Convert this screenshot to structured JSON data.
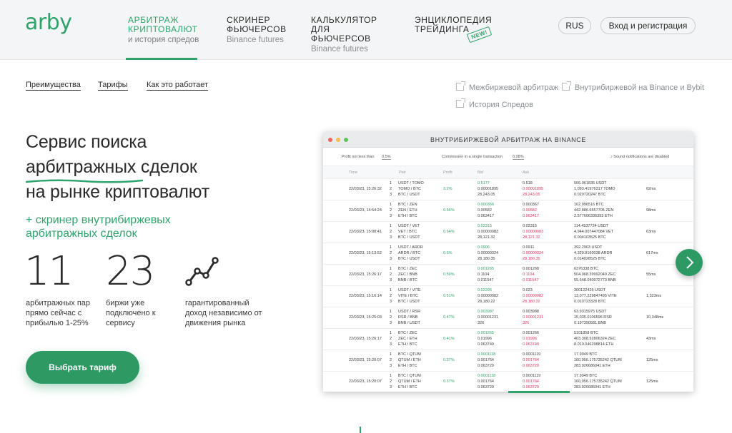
{
  "brand": {
    "logo": "arby",
    "accent": "#2fa36b"
  },
  "nav": [
    {
      "title": "АРБИТРАЖ КРИПТОВАЛЮТ",
      "sub": "и история спредов"
    },
    {
      "title": "СКРИНЕР ФЬЮЧЕРСОВ",
      "sub": "Binance futures"
    },
    {
      "title": "КАЛЬКУЛЯТОР ДЛЯ ФЬЮЧЕРСОВ",
      "sub": "Binance futures"
    },
    {
      "title": "ЭНЦИКЛОПЕДИЯ ТРЕЙДИНГА",
      "badge": "NEW!"
    }
  ],
  "header": {
    "lang": "RUS",
    "login": "Вход и регистрация"
  },
  "subnav": [
    "Преимущества",
    "Тарифы",
    "Как это работает"
  ],
  "links": [
    "Межбиржевой арбитраж",
    "Внутрибиржевой на Binance и Bybit",
    "История Спредов"
  ],
  "hero": {
    "line1": "Сервис поиска",
    "line2": "арбитражных сделок",
    "line3": "на рынке криптовалют",
    "sub1": "+ скринер внутрибиржевых",
    "sub2": "арбитражных сделок"
  },
  "stats": [
    {
      "value": "11",
      "desc": [
        "арбитражных пар",
        "прямо сейчас с",
        "прибылью 1-25%"
      ]
    },
    {
      "value": "23",
      "desc": [
        "биржи уже",
        "подключено к",
        "сервису"
      ]
    },
    {
      "icon": "chart-line-icon",
      "desc": [
        "гарантированный",
        "доход независимо от",
        "движения рынка"
      ]
    }
  ],
  "cta": "Выбрать тариф",
  "screen": {
    "title": "ВНУТРИБИРЖЕВОЙ АРБИТРАЖ НА BINANCE",
    "filter_profit_label": "Profit not less than",
    "filter_profit_value": "0,5%",
    "filter_commission_label": "Commission in a single transaction",
    "filter_commission_value": "0,08%",
    "sound": "Sound notifications are disabled",
    "columns": [
      "Time",
      "Pair",
      "Profit",
      "Bid",
      "Ask",
      "",
      ""
    ],
    "rows": [
      {
        "time": "22/03/23, 15:26:32",
        "pairs": [
          "USDT / TOMO",
          "TOMO / BTC",
          "BTC / USDT"
        ],
        "profit": "3.2%",
        "bid": [
          "0.5177",
          "0.00001895",
          "28,243.05"
        ],
        "ask": [
          "0.518",
          "0.00001895",
          "28,243.05"
        ],
        "vol": [
          "566.061835 USDT",
          "1,093.41976317 TOMO",
          "0.020720247 BTC"
        ],
        "ms": "62ms"
      },
      {
        "time": "22/03/23, 14:54:24",
        "pairs": [
          "BTC / ZEN",
          "ZEN / ETH",
          "ETH / BTC"
        ],
        "profit": "0.66%",
        "bid": [
          "0.000366",
          "0.00582",
          "0.063417"
        ],
        "ask": [
          "0.000367",
          "0.00582",
          "0.063417"
        ],
        "vol": [
          "162.096516 BTC",
          "442.886.6557705 ZEN",
          "2.577606336393 ETH"
        ],
        "ms": "98ms"
      },
      {
        "time": "22/03/23, 15:08:41",
        "pairs": [
          "USDT / VET",
          "VET / BTC",
          "BTC / USDT"
        ],
        "profit": "0.64%",
        "bid": [
          "0.02315",
          "0.00000083",
          "28,121.32"
        ],
        "ask": [
          "0.02315",
          "0.00000083",
          "28,121.32"
        ],
        "vol": [
          "114.4537724 USDT",
          "4,944.007447084 VET",
          "0.004103525 BTC"
        ],
        "ms": "63ms"
      },
      {
        "time": "22/03/23, 15:13:52",
        "pairs": [
          "USDT / ARDR",
          "ARDR / BTC",
          "BTC / USDT"
        ],
        "profit": "0.6%",
        "bid": [
          "0.0906",
          "0.00000324",
          "28,180.35"
        ],
        "ask": [
          "0.0911",
          "0.00000324",
          "28,180.35"
        ],
        "vol": [
          "392.2903 USDT",
          "4,329.9160038 ARDR",
          "0.014028525 BTC"
        ],
        "ms": "617ms"
      },
      {
        "time": "22/03/23, 15:26:17",
        "pairs": [
          "BTC / ZEC",
          "ZEC / BNB",
          "BNB / BTC"
        ],
        "profit": "0.59%",
        "bid": [
          "0.001265",
          "0.1104",
          "0.011547"
        ],
        "ask": [
          "0.001268",
          "0.1104",
          "0.011547"
        ],
        "vol": [
          "6376338 BTC",
          "504.068.39992049 ZEC",
          "55.648.040972773 BNB"
        ],
        "ms": "55ms"
      },
      {
        "time": "22/03/23, 15:16:14",
        "pairs": [
          "USDT / VITE",
          "VITE / BTC",
          "BTC / USDT"
        ],
        "profit": "0.51%",
        "bid": [
          "0.02295",
          "0.00000082",
          "28,180.22"
        ],
        "ask": [
          "0.023",
          "0.00000082",
          "28,180.22"
        ],
        "vol": [
          "300122425 USDT",
          "13,077.229847495 VITE",
          "0.010723328 BTC"
        ],
        "ms": "1,323ms"
      },
      {
        "time": "22/03/23, 15:25:03",
        "pairs": [
          "USDT / RSR",
          "RSR / BNB",
          "BNB / USDT"
        ],
        "profit": "0.47%",
        "bid": [
          "0.003987",
          "0.00001231",
          "326"
        ],
        "ask": [
          "0.003988",
          "0.00001231",
          "326"
        ],
        "vol": [
          "63.9315975 USDT",
          "15,035.0106596 RSR",
          "0.197390581 BNB"
        ],
        "ms": "10,348ms"
      },
      {
        "time": "22/03/23, 15:26:17",
        "pairs": [
          "BTC / ZEC",
          "ZEC / ETH",
          "ETH / BTC"
        ],
        "profit": "0.41%",
        "bid": [
          "0.001265",
          "0.01996",
          "0.063749"
        ],
        "ask": [
          "0.001266",
          "0.01996",
          "0.063749"
        ],
        "vol": [
          "5101858 BTC",
          "403.308.92806324 ZEC",
          "8.010.046298814 ETH"
        ],
        "ms": "43ms"
      },
      {
        "time": "22/03/23, 15:20:07",
        "pairs": [
          "BTC / QTUM",
          "QTUM / ETH",
          "ETH / BTC"
        ],
        "profit": "0.37%",
        "bid": [
          "0.0001118",
          "0.001764",
          "0.063729"
        ],
        "ask": [
          "0.0001119",
          "0.001764",
          "0.063729"
        ],
        "vol": [
          "17.9949 BTC",
          "160,956.175735242 QTUM",
          "283.926686041 ETH"
        ],
        "ms": "125ms"
      },
      {
        "time": "22/03/23, 15:20:07",
        "pairs": [
          "BTC / QTUM",
          "QTUM / ETH",
          "ETH / BTC"
        ],
        "profit": "0.37%",
        "bid": [
          "0.0001118",
          "0.001764",
          "0.063729"
        ],
        "ask": [
          "0.0001119",
          "0.001764",
          "0.063729"
        ],
        "vol": [
          "17.9949 BTC",
          "160,956.175735242 QTUM",
          "283.926686041 ETH"
        ],
        "ms": "125ms"
      }
    ]
  }
}
